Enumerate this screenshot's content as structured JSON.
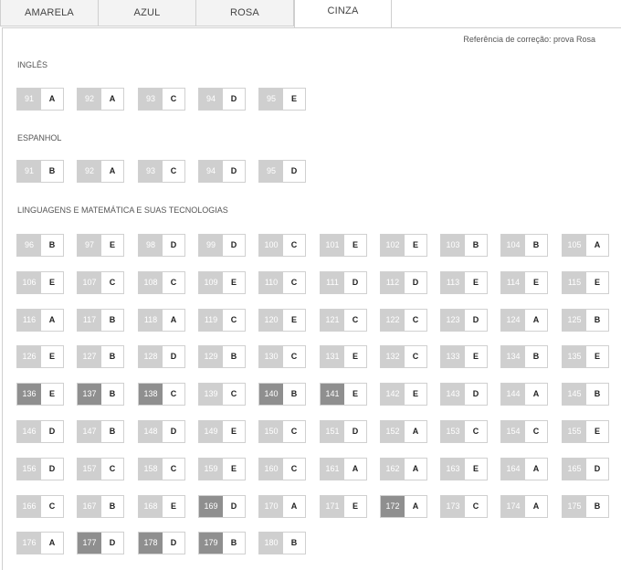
{
  "tabs": [
    {
      "label": "AMARELA",
      "active": false
    },
    {
      "label": "AZUL",
      "active": false
    },
    {
      "label": "ROSA",
      "active": false
    },
    {
      "label": "CINZA",
      "active": true
    }
  ],
  "reference": "Referência de correção: prova Rosa",
  "sections": [
    {
      "title": "INGLÊS",
      "items": [
        {
          "num": "91",
          "ans": "A"
        },
        {
          "num": "92",
          "ans": "A"
        },
        {
          "num": "93",
          "ans": "C"
        },
        {
          "num": "94",
          "ans": "D"
        },
        {
          "num": "95",
          "ans": "E"
        }
      ]
    },
    {
      "title": "ESPANHOL",
      "items": [
        {
          "num": "91",
          "ans": "B"
        },
        {
          "num": "92",
          "ans": "A"
        },
        {
          "num": "93",
          "ans": "C"
        },
        {
          "num": "94",
          "ans": "D"
        },
        {
          "num": "95",
          "ans": "D"
        }
      ]
    },
    {
      "title": "LINGUAGENS E MATEMÁTICA E SUAS TECNOLOGIAS",
      "items": [
        {
          "num": "96",
          "ans": "B"
        },
        {
          "num": "97",
          "ans": "E"
        },
        {
          "num": "98",
          "ans": "D"
        },
        {
          "num": "99",
          "ans": "D"
        },
        {
          "num": "100",
          "ans": "C"
        },
        {
          "num": "101",
          "ans": "E"
        },
        {
          "num": "102",
          "ans": "E"
        },
        {
          "num": "103",
          "ans": "B"
        },
        {
          "num": "104",
          "ans": "B"
        },
        {
          "num": "105",
          "ans": "A"
        },
        {
          "num": "106",
          "ans": "E"
        },
        {
          "num": "107",
          "ans": "C"
        },
        {
          "num": "108",
          "ans": "C"
        },
        {
          "num": "109",
          "ans": "E"
        },
        {
          "num": "110",
          "ans": "C"
        },
        {
          "num": "111",
          "ans": "D"
        },
        {
          "num": "112",
          "ans": "D"
        },
        {
          "num": "113",
          "ans": "E"
        },
        {
          "num": "114",
          "ans": "E"
        },
        {
          "num": "115",
          "ans": "E"
        },
        {
          "num": "116",
          "ans": "A"
        },
        {
          "num": "117",
          "ans": "B"
        },
        {
          "num": "118",
          "ans": "A"
        },
        {
          "num": "119",
          "ans": "C"
        },
        {
          "num": "120",
          "ans": "E"
        },
        {
          "num": "121",
          "ans": "C"
        },
        {
          "num": "122",
          "ans": "C"
        },
        {
          "num": "123",
          "ans": "D"
        },
        {
          "num": "124",
          "ans": "A"
        },
        {
          "num": "125",
          "ans": "B"
        },
        {
          "num": "126",
          "ans": "E"
        },
        {
          "num": "127",
          "ans": "B"
        },
        {
          "num": "128",
          "ans": "D"
        },
        {
          "num": "129",
          "ans": "B"
        },
        {
          "num": "130",
          "ans": "C"
        },
        {
          "num": "131",
          "ans": "E"
        },
        {
          "num": "132",
          "ans": "C"
        },
        {
          "num": "133",
          "ans": "E"
        },
        {
          "num": "134",
          "ans": "B"
        },
        {
          "num": "135",
          "ans": "E"
        },
        {
          "num": "136",
          "ans": "E",
          "hl": true
        },
        {
          "num": "137",
          "ans": "B",
          "hl": true
        },
        {
          "num": "138",
          "ans": "C",
          "hl": true
        },
        {
          "num": "139",
          "ans": "C"
        },
        {
          "num": "140",
          "ans": "B",
          "hl": true
        },
        {
          "num": "141",
          "ans": "E",
          "hl": true
        },
        {
          "num": "142",
          "ans": "E"
        },
        {
          "num": "143",
          "ans": "D"
        },
        {
          "num": "144",
          "ans": "A"
        },
        {
          "num": "145",
          "ans": "B"
        },
        {
          "num": "146",
          "ans": "D"
        },
        {
          "num": "147",
          "ans": "B"
        },
        {
          "num": "148",
          "ans": "D"
        },
        {
          "num": "149",
          "ans": "E"
        },
        {
          "num": "150",
          "ans": "C"
        },
        {
          "num": "151",
          "ans": "D"
        },
        {
          "num": "152",
          "ans": "A"
        },
        {
          "num": "153",
          "ans": "C"
        },
        {
          "num": "154",
          "ans": "C"
        },
        {
          "num": "155",
          "ans": "E"
        },
        {
          "num": "156",
          "ans": "D"
        },
        {
          "num": "157",
          "ans": "C"
        },
        {
          "num": "158",
          "ans": "C"
        },
        {
          "num": "159",
          "ans": "E"
        },
        {
          "num": "160",
          "ans": "C"
        },
        {
          "num": "161",
          "ans": "A"
        },
        {
          "num": "162",
          "ans": "A"
        },
        {
          "num": "163",
          "ans": "E"
        },
        {
          "num": "164",
          "ans": "A"
        },
        {
          "num": "165",
          "ans": "D"
        },
        {
          "num": "166",
          "ans": "C"
        },
        {
          "num": "167",
          "ans": "B"
        },
        {
          "num": "168",
          "ans": "E"
        },
        {
          "num": "169",
          "ans": "D",
          "hl": true
        },
        {
          "num": "170",
          "ans": "A"
        },
        {
          "num": "171",
          "ans": "E"
        },
        {
          "num": "172",
          "ans": "A",
          "hl": true
        },
        {
          "num": "173",
          "ans": "C"
        },
        {
          "num": "174",
          "ans": "A"
        },
        {
          "num": "175",
          "ans": "B"
        },
        {
          "num": "176",
          "ans": "A"
        },
        {
          "num": "177",
          "ans": "D",
          "hl": true
        },
        {
          "num": "178",
          "ans": "D",
          "hl": true
        },
        {
          "num": "179",
          "ans": "B",
          "hl": true
        },
        {
          "num": "180",
          "ans": "B"
        }
      ]
    }
  ],
  "colors": {
    "number_bg": "#cfcfcf",
    "number_bg_highlight": "#8f8f8f",
    "border": "#d0d0d0"
  }
}
